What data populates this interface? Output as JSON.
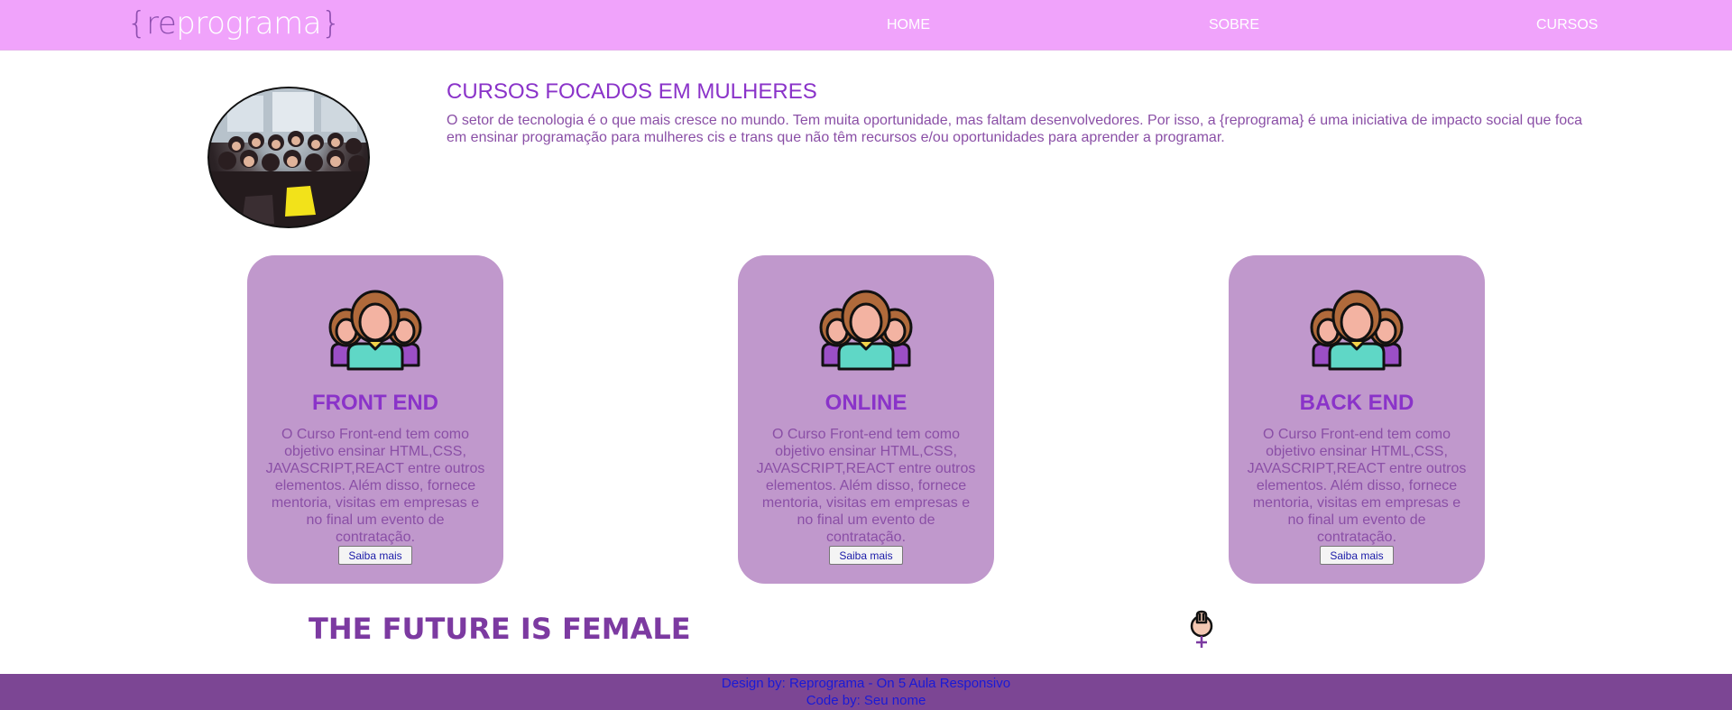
{
  "header": {
    "logo": {
      "open": "{",
      "re": "re",
      "prog": "programa",
      "close": "}"
    },
    "nav": [
      "HOME",
      "SOBRE",
      "CURSOS"
    ]
  },
  "hero": {
    "title": "CURSOS FOCADOS EM MULHERES",
    "text": "O setor de tecnologia é o que mais cresce no mundo. Tem muita oportunidade, mas faltam desenvolvedores. Por isso, a {reprograma} é uma iniciativa de impacto social que foca em ensinar programação para mulheres cis e trans que não têm recursos e/ou oportunidades para aprender a programar."
  },
  "cards": [
    {
      "title": "FRONT END",
      "text": "O Curso Front-end tem como objetivo ensinar HTML,CSS, JAVASCRIPT,REACT entre outros elementos. Além disso, fornece mentoria, visitas em empresas e no final um evento de contratação.",
      "button": "Saiba mais"
    },
    {
      "title": "ONLINE",
      "text": "O Curso Front-end tem como objetivo ensinar HTML,CSS, JAVASCRIPT,REACT entre outros elementos. Além disso, fornece mentoria, visitas em empresas e no final um evento de contratação.",
      "button": "Saiba mais"
    },
    {
      "title": "BACK END",
      "text": "O Curso Front-end tem como objetivo ensinar HTML,CSS, JAVASCRIPT,REACT entre outros elementos. Além disso, fornece mentoria, visitas em empresas e no final um evento de contratação.",
      "button": "Saiba mais"
    }
  ],
  "banner": {
    "text": "THE FUTURE IS FEMALE",
    "icon": "feminist-fist-icon"
  },
  "footer": {
    "line1": "Design by: Reprograma - On 5 Aula Responsivo",
    "line2": "Code by: Seu nome"
  },
  "colors": {
    "navbar": "#f0a3fb",
    "card": "#c098cc",
    "title": "#8a33c9",
    "footer": "#7c4694"
  }
}
